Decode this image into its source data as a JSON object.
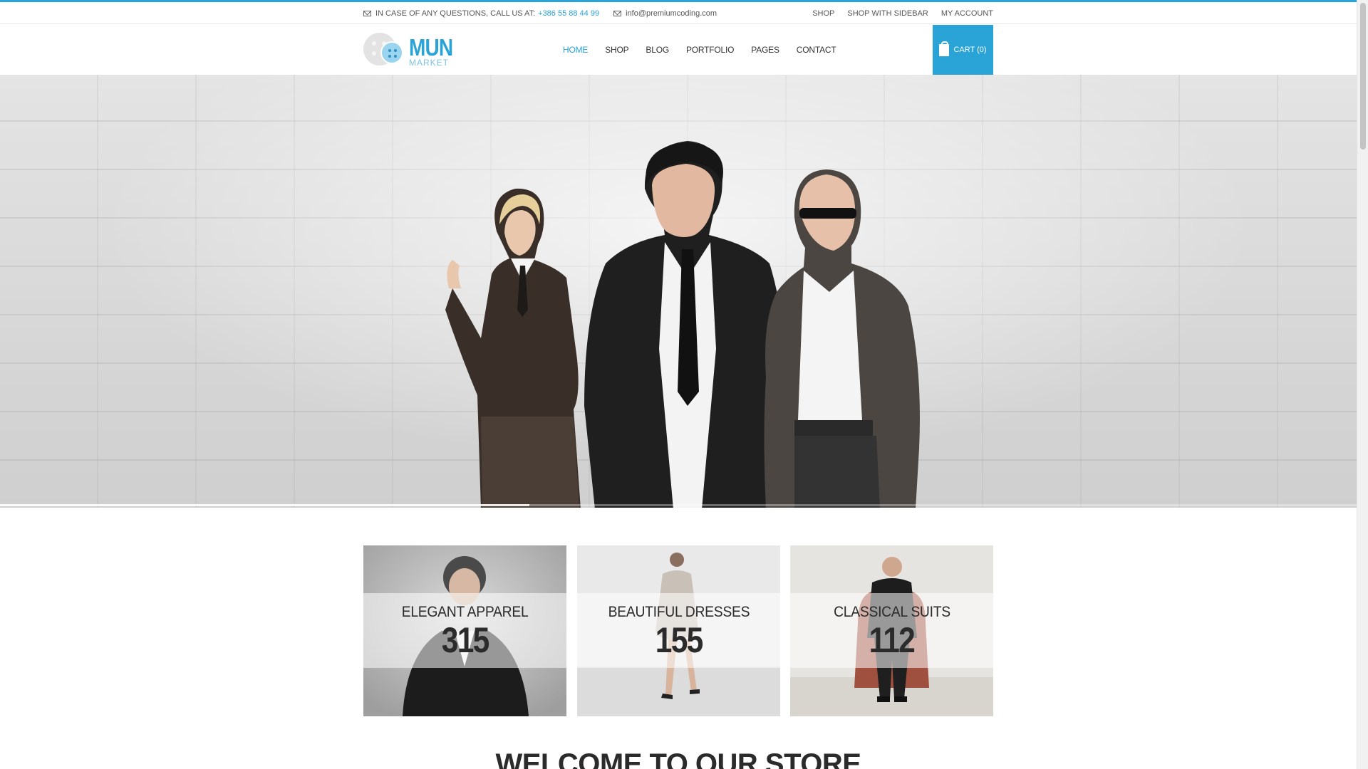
{
  "topbar": {
    "contact_prefix": "IN CASE OF ANY QUESTIONS, CALL US AT:",
    "phone": "+386 55 88 44 99",
    "email": "info@premiumcoding.com",
    "links": [
      "SHOP",
      "SHOP WITH SIDEBAR",
      "MY ACCOUNT"
    ]
  },
  "logo": {
    "main": "MUN",
    "sub": "MARKET"
  },
  "nav": {
    "items": [
      "HOME",
      "SHOP",
      "BLOG",
      "PORTFOLIO",
      "PAGES",
      "CONTACT"
    ],
    "active": "HOME"
  },
  "cart": {
    "label": "CART (0)"
  },
  "hero": {
    "slide_progress": 0.39
  },
  "tiles": [
    {
      "label": "ELEGANT APPAREL",
      "count": "315"
    },
    {
      "label": "BEAUTIFUL DRESSES",
      "count": "155"
    },
    {
      "label": "CLASSICAL SUITS",
      "count": "112"
    }
  ],
  "welcome": {
    "heading": "WELCOME TO OUR STORE"
  },
  "colors": {
    "accent": "#2aa3d6",
    "text": "#2b2b2b"
  },
  "icons": [
    "mail-icon",
    "shopping-bag-icon"
  ]
}
